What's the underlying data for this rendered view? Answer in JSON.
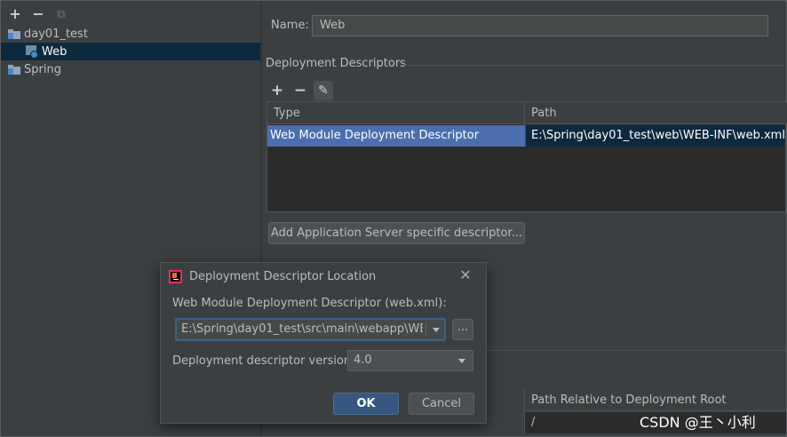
{
  "tree": {
    "toolbar": {
      "add_icon": "+",
      "remove_icon": "−",
      "copy_icon": "⧉"
    },
    "items": [
      {
        "label": "day01_test",
        "icon": "module-folder-icon"
      },
      {
        "label": "Web",
        "icon": "web-facet-icon",
        "selected": true
      },
      {
        "label": "Spring",
        "icon": "module-folder-icon"
      }
    ]
  },
  "facet": {
    "name_label": "Name:",
    "name_value": "Web",
    "section_title": "Deployment Descriptors",
    "toolbar": {
      "add_icon": "+",
      "remove_icon": "−",
      "edit_icon": "✎"
    },
    "table": {
      "columns": [
        "Type",
        "Path"
      ],
      "rows": [
        {
          "type": "Web Module Deployment Descriptor",
          "path": "E:\\Spring\\day01_test\\web\\WEB-INF\\web.xml"
        }
      ]
    },
    "add_button_label": "Add Application Server specific descriptor...",
    "second_table": {
      "path_header": "Path Relative to Deployment Root",
      "path_value": "/"
    }
  },
  "dialog": {
    "title": "Deployment Descriptor Location",
    "close_icon": "✕",
    "path_label": "Web Module Deployment Descriptor (web.xml):",
    "path_value": "E:\\Spring\\day01_test\\src\\main\\webapp\\WEB-I",
    "browse_label": "...",
    "version_label": "Deployment descriptor version",
    "version_value": "4.0",
    "ok_label": "OK",
    "cancel_label": "Cancel"
  },
  "watermark": "CSDN @王丶小利",
  "colors": {
    "background": "#3c3f41",
    "selection": "#4b6eaf",
    "tree_selection": "#0d293e",
    "ok_button": "#365880"
  }
}
